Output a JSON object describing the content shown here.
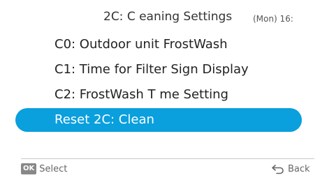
{
  "header": {
    "title": "2C: C eaning Settings",
    "clock": "(Mon) 16:"
  },
  "menu": {
    "items": [
      {
        "label": "C0: Outdoor unit FrostWash",
        "selected": false
      },
      {
        "label": "C1: Time for Filter Sign Display",
        "selected": false
      },
      {
        "label": "C2: FrostWash T me Setting",
        "selected": false
      },
      {
        "label": "Reset 2C: Clean",
        "selected": true
      }
    ]
  },
  "footer": {
    "ok_badge": "OK",
    "select_label": "Select",
    "back_label": "Back"
  },
  "colors": {
    "selected_background": "#0a9fdd",
    "selected_text": "#ffffff",
    "badge_background": "#888888"
  },
  "icons": {
    "ok": "ok-badge",
    "back": "back-arrow-icon"
  }
}
